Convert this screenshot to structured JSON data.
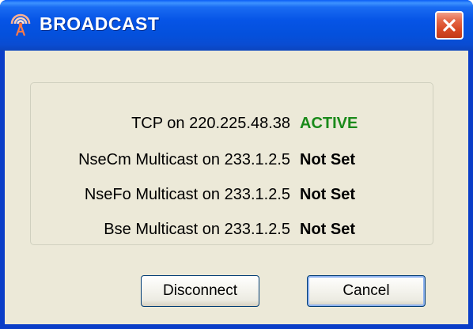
{
  "window": {
    "title": "BROADCAST",
    "icon": "broadcast-antenna-icon",
    "close_icon": "close-icon"
  },
  "connections": [
    {
      "label": "TCP on 220.225.48.38",
      "status": "ACTIVE",
      "status_color": "#1a8a1a"
    },
    {
      "label": "NseCm Multicast on 233.1.2.5",
      "status": "Not Set",
      "status_color": "#000000"
    },
    {
      "label": "NseFo Multicast on 233.1.2.5",
      "status": "Not Set",
      "status_color": "#000000"
    },
    {
      "label": "Bse Multicast on 233.1.2.5",
      "status": "Not Set",
      "status_color": "#000000"
    }
  ],
  "buttons": {
    "disconnect": "Disconnect",
    "cancel": "Cancel"
  },
  "colors": {
    "titlebar": "#0654e6",
    "client_background": "#ece9d8",
    "close_button": "#d84a25"
  }
}
